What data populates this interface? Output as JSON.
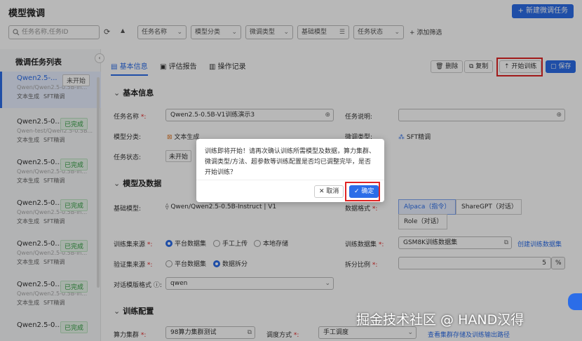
{
  "header": {
    "title": "模型微调",
    "new_task_label": "+ 新建微调任务"
  },
  "filters": {
    "search_placeholder": "任务名称,任务ID",
    "task_name": "任务名称",
    "model_category": "模型分类",
    "finetune_type": "微调类型",
    "base_model": "基础模型",
    "task_status": "任务状态",
    "add_filter": "+ 添加筛选"
  },
  "sidebar": {
    "title": "微调任务列表",
    "tasks": [
      {
        "name": "Qwen2.5-...",
        "status": "未开始",
        "sub": "Qwen/Qwen2.5-0.5B-In...",
        "category": "文本生成",
        "method": "SFT精调"
      },
      {
        "name": "Qwen2.5-0...",
        "status": "已完成",
        "sub": "Qwen-test/Qwen2.5-0.5B...",
        "category": "文本生成",
        "method": "SFT精调"
      },
      {
        "name": "Qwen2.5-0...",
        "status": "已完成",
        "sub": "Qwen/Qwen2.5-0.5B-In...",
        "category": "文本生成",
        "method": "SFT精调"
      },
      {
        "name": "Qwen2.5-0...",
        "status": "已完成",
        "sub": "Qwen/Qwen2.5-0.5B-In...",
        "category": "文本生成",
        "method": "SFT精调"
      },
      {
        "name": "Qwen2.5-0...",
        "status": "已完成",
        "sub": "Qwen/Qwen2.5-0.5B-In...",
        "category": "文本生成",
        "method": "SFT精调"
      },
      {
        "name": "Qwen2.5-0...",
        "status": "已完成",
        "sub": "Qwen/Qwen2.5-0.5B-In...",
        "category": "文本生成",
        "method": "SFT精调"
      },
      {
        "name": "Qwen2.5-0...",
        "status": "已完成",
        "sub": "",
        "category": "",
        "method": ""
      }
    ]
  },
  "tabs": {
    "basic": "基本信息",
    "eval": "评估报告",
    "log": "操作记录"
  },
  "actions": {
    "delete": "删除",
    "copy": "复制",
    "start": "开始训练",
    "save": "保存"
  },
  "basic_info": {
    "section_title": "基本信息",
    "task_name_label": "任务名称",
    "task_name_value": "Qwen2.5-0.5B-V1训练演示3",
    "task_desc_label": "任务说明",
    "category_label": "模型分类",
    "category_value": "文本生成",
    "finetune_type_label": "微调类型",
    "finetune_type_value": "SFT精调",
    "status_label": "任务状态",
    "status_value": "未开始"
  },
  "model_data": {
    "section_title": "模型及数据",
    "base_model_label": "基础模型",
    "base_model_value": "Qwen/Qwen2.5-0.5B-Instruct | V1",
    "data_format_label": "数据格式",
    "formats": [
      "Alpaca（指令）",
      "ShareGPT（对话）",
      "Role（对话）"
    ],
    "train_source_label": "训练集来源",
    "train_sources": [
      "平台数据集",
      "手工上传",
      "本地存储"
    ],
    "train_dataset_label": "训练数据集",
    "train_dataset_value": "GSM8K训练数据集",
    "create_dataset_link": "创建训练数据集",
    "val_source_label": "验证集来源",
    "val_sources": [
      "平台数据集",
      "数据拆分"
    ],
    "split_label": "拆分比例",
    "split_value": "5",
    "split_unit": "%",
    "template_label": "对话模版格式",
    "template_value": "qwen"
  },
  "train_config": {
    "section_title": "训练配置",
    "compute_label": "算力集群",
    "compute_value": "98算力集群测试",
    "schedule_label": "调度方式",
    "schedule_value": "手工调度",
    "storage_link": "查看集群存储及训练输出路径"
  },
  "dialog": {
    "message": "训练即将开始！请再次确认训练所需模型及数据，算力集群、微调类型/方法、超参数等训练配置是否均已调整完毕，是否开始训练？",
    "cancel": "取消",
    "confirm": "确定"
  },
  "watermark": "掘金技术社区 @ HAND汉得",
  "colors": {
    "accent": "#2b6de8",
    "highlight": "#e02424",
    "success": "#2e9b3f"
  }
}
